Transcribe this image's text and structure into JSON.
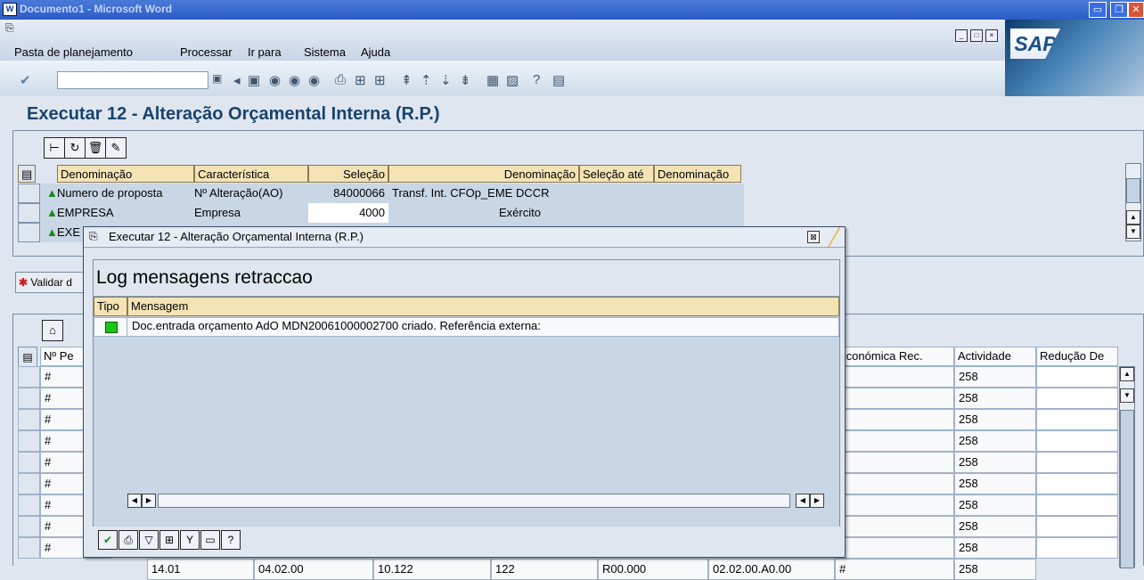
{
  "window": {
    "title": "Documento1 - Microsoft Word"
  },
  "menu": {
    "items": [
      "Pasta de planejamento",
      "Processar",
      "Ir para",
      "Sistema",
      "Ajuda"
    ]
  },
  "sap": {
    "logo": "SAP"
  },
  "page": {
    "title": "Executar 12 - Alteração Orçamental Interna (R.P.)"
  },
  "selection_table": {
    "headers": [
      "Denominação",
      "Característica",
      "Seleção",
      "Denominação",
      "Seleção até",
      "Denominação"
    ],
    "rows": [
      {
        "name": "Numero de proposta",
        "characteristic": "Nº Alteração(AO)",
        "selection": "84000066",
        "description": "Transf. Int. CFOp_EME DCCR"
      },
      {
        "name": "EMPRESA",
        "characteristic": "Empresa",
        "selection": "4000",
        "description": "Exército"
      },
      {
        "name": "EXE",
        "characteristic": "",
        "selection": "",
        "description": ""
      }
    ]
  },
  "validar": {
    "label": "Validar d"
  },
  "lower_table": {
    "headers": [
      "Nº Pe",
      "Económica Rec.",
      "Actividade",
      "Redução De"
    ],
    "rows": [
      {
        "id": "#",
        "econ": "",
        "activity": "258"
      },
      {
        "id": "#",
        "econ": "",
        "activity": "258"
      },
      {
        "id": "#",
        "econ": "",
        "activity": "258"
      },
      {
        "id": "#",
        "econ": "",
        "activity": "258"
      },
      {
        "id": "#",
        "econ": "",
        "activity": "258"
      },
      {
        "id": "#",
        "econ": "",
        "activity": "258"
      },
      {
        "id": "#",
        "econ": "",
        "activity": "258"
      },
      {
        "id": "#",
        "econ": "",
        "activity": "258"
      },
      {
        "id": "#",
        "econ": "",
        "activity": "258"
      }
    ],
    "partial_row": [
      "14.01",
      "04.02.00",
      "10.122",
      "122",
      "R00.000",
      "02.02.00.A0.00",
      "#",
      "258"
    ]
  },
  "dialog": {
    "title": "Executar 12 - Alteração Orçamental Interna (R.P.)",
    "heading": "Log mensagens retraccao",
    "columns": [
      "Tipo",
      "Mensagem"
    ],
    "messages": [
      {
        "status": "green",
        "text": "Doc.entrada orçamento AdO MDN20061000002700 criado. Referência externa:"
      }
    ]
  },
  "colors": {
    "title_bar": "#2b5cc7",
    "header_cell": "#f4e3b5",
    "heading_text": "#19436d",
    "status_ok": "#19c419"
  }
}
